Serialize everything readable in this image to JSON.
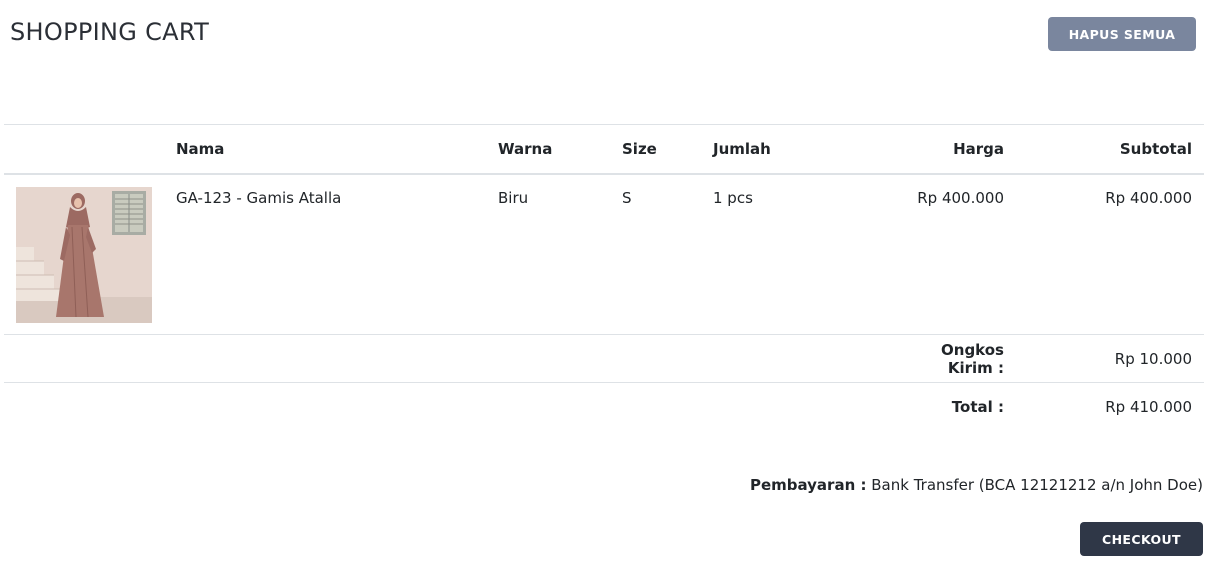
{
  "header": {
    "title": "SHOPPING CART",
    "clear_all_label": "HAPUS SEMUA"
  },
  "table": {
    "columns": [
      "Nama",
      "Warna",
      "Size",
      "Jumlah",
      "Harga",
      "Subtotal"
    ],
    "items": [
      {
        "name": "GA-123 - Gamis Atalla",
        "color": "Biru",
        "size": "S",
        "qty": "1 pcs",
        "price": "Rp 400.000",
        "subtotal": "Rp 400.000",
        "image": "product-photo-gamis"
      }
    ],
    "shipping_label": "Ongkos Kirim :",
    "shipping_value": "Rp 10.000",
    "total_label": "Total :",
    "total_value": "Rp 410.000"
  },
  "payment": {
    "label": "Pembayaran :",
    "value": "Bank Transfer (BCA 12121212 a/n John Doe)"
  },
  "checkout_label": "CHECKOUT",
  "colors": {
    "clear_button": "#7a869e",
    "checkout_button": "#2f3747",
    "border": "#dee2e6"
  }
}
